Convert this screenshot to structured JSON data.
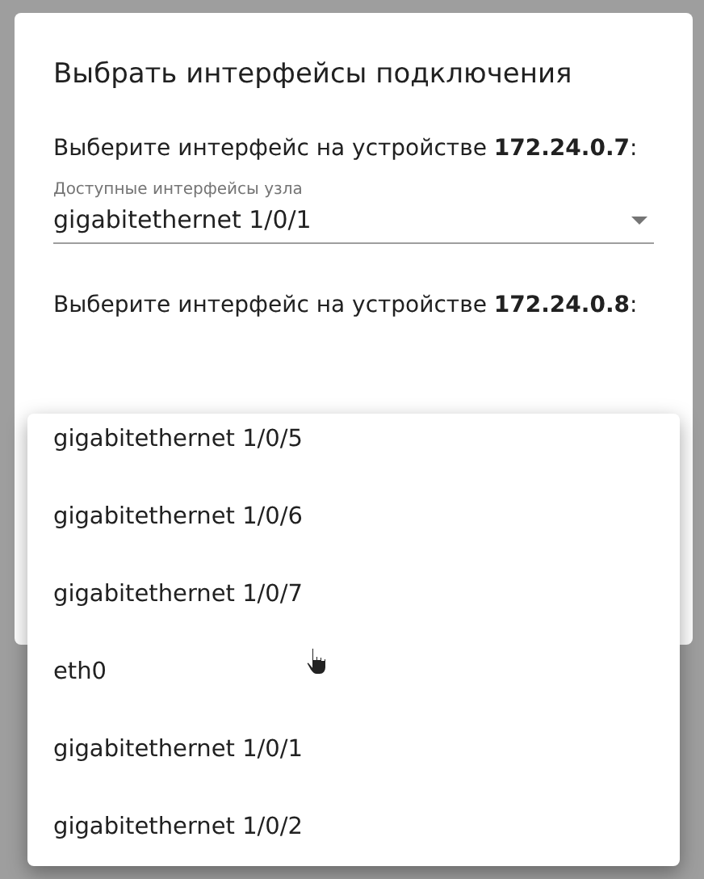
{
  "dialog": {
    "title": "Выбрать интерфейсы подключения",
    "sections": [
      {
        "prompt": "Выберите интерфейс на устройстве **172.24.0.7**:",
        "field": {
          "label": "Доступные интерфейсы узла",
          "value": "gigabitethernet 1/0/1"
        }
      },
      {
        "prompt": "Выберите интерфейс на устройстве **172.24.0.8**:"
      }
    ]
  },
  "menu": {
    "items": [
      "gigabitethernet 1/0/5",
      "gigabitethernet 1/0/6",
      "gigabitethernet 1/0/7",
      "eth0",
      "gigabitethernet 1/0/1",
      "gigabitethernet 1/0/2"
    ]
  }
}
